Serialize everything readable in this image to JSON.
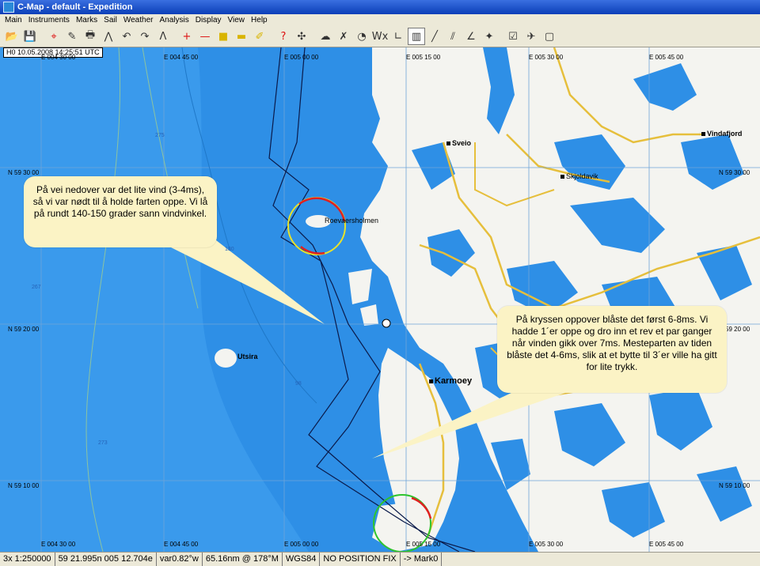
{
  "window": {
    "title": "C-Map - default - Expedition"
  },
  "menu": [
    "Main",
    "Instruments",
    "Marks",
    "Sail",
    "Weather",
    "Analysis",
    "Display",
    "View",
    "Help"
  ],
  "toolbar": {
    "buttons": [
      {
        "name": "open-icon",
        "glyph": "📂"
      },
      {
        "name": "save-icon",
        "glyph": "💾"
      },
      {
        "name": "sep"
      },
      {
        "name": "crosshair-icon",
        "glyph": "⌖",
        "color": "red"
      },
      {
        "name": "edit-icon",
        "glyph": "✎"
      },
      {
        "name": "print-icon",
        "glyph": "🖶"
      },
      {
        "name": "route-icon",
        "glyph": "⋀"
      },
      {
        "name": "undo-icon",
        "glyph": "↶"
      },
      {
        "name": "redo-icon",
        "glyph": "↷"
      },
      {
        "name": "mark-line-icon",
        "glyph": "Λ"
      },
      {
        "name": "sep"
      },
      {
        "name": "add-mark-icon",
        "glyph": "+",
        "color": "red"
      },
      {
        "name": "line-icon",
        "glyph": "—",
        "color": "red"
      },
      {
        "name": "box-icon",
        "glyph": "■",
        "color": "yellow"
      },
      {
        "name": "highlight-icon",
        "glyph": "▬",
        "color": "yellow"
      },
      {
        "name": "pen-icon",
        "glyph": "✐",
        "color": "yellow"
      },
      {
        "name": "sep"
      },
      {
        "name": "help-icon",
        "glyph": "?",
        "color": "red"
      },
      {
        "name": "wind-icon",
        "glyph": "✣"
      },
      {
        "name": "sep"
      },
      {
        "name": "cloud-icon",
        "glyph": "☁"
      },
      {
        "name": "measure-icon",
        "glyph": "✗"
      },
      {
        "name": "polar-icon",
        "glyph": "◔"
      },
      {
        "name": "wx-icon",
        "glyph": "Wx"
      },
      {
        "name": "tack-icon",
        "glyph": "∟"
      },
      {
        "name": "grid-icon",
        "glyph": "▥",
        "pressed": true
      },
      {
        "name": "slash-icon",
        "glyph": "╱"
      },
      {
        "name": "double-slash-icon",
        "glyph": "⫽"
      },
      {
        "name": "angle-icon",
        "glyph": "∠"
      },
      {
        "name": "compass-icon",
        "glyph": "✦"
      },
      {
        "name": "sep"
      },
      {
        "name": "checklist-icon",
        "glyph": "☑"
      },
      {
        "name": "gps-icon",
        "glyph": "✈"
      },
      {
        "name": "window-icon",
        "glyph": "▢"
      }
    ]
  },
  "chart": {
    "datetime": "H0 10.05.2008 14:25:51 UTC",
    "lon_labels_top": [
      "E 004 30 00",
      "E 004 45 00",
      "E 005 00 00",
      "E 005 15 00",
      "E 005 30 00",
      "E 005 45 00"
    ],
    "lon_labels_bottom": [
      "E 004 30 00",
      "E 004 45 00",
      "E 005 00 00",
      "E 005 15 00",
      "E 005 30 00",
      "E 005 45 00"
    ],
    "lat_labels_left": [
      "N 59 30 00",
      "N 59 20 00",
      "N 59 10 00"
    ],
    "lat_labels_right": [
      "N 59 30 00",
      "N 59 20 00",
      "N 59 10 00"
    ],
    "places": [
      {
        "name": "Sveio"
      },
      {
        "name": "Vindafjord"
      },
      {
        "name": "Skjoldavik"
      },
      {
        "name": "Roevaersholmen"
      },
      {
        "name": "Utsira"
      },
      {
        "name": "Karmoey"
      }
    ],
    "depths": [
      "275",
      "180",
      "267",
      "98",
      "273"
    ],
    "callouts": [
      "På vei nedover var det lite vind (3-4ms), så vi var nødt til å holde farten oppe. Vi lå på rundt 140-150 grader sann vindvinkel.",
      "På kryssen oppover blåste det først 6-8ms. Vi hadde 1´er oppe og dro inn et rev et par ganger når vinden gikk over 7ms. Mesteparten av tiden blåste det 4-6ms, slik at et bytte til 3´er ville ha gitt for lite trykk."
    ]
  },
  "status": {
    "scale": "3x 1:250000",
    "position": "59 21.995n 005 12.704e",
    "variation": "var0.82°w",
    "range_bearing": "65.16nm @ 178°M",
    "datum": "WGS84",
    "fix": "NO POSITION FIX",
    "mark": "-> Mark0"
  },
  "colors": {
    "sea": "#2e8fe6",
    "land": "#f4f4f0",
    "shallow": "#5aaaf0",
    "road": "#e6bf3c",
    "track": "#0a1a4a"
  }
}
